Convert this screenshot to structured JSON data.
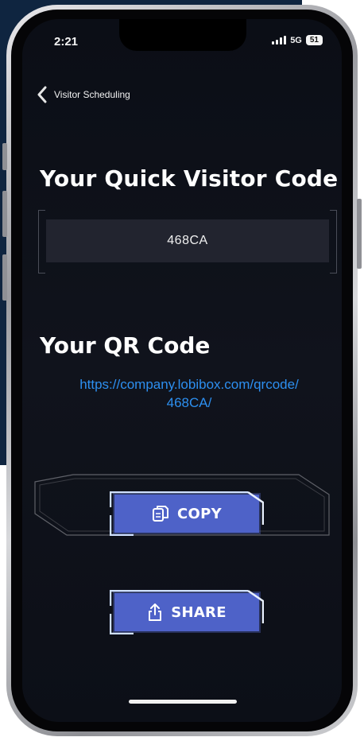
{
  "status_bar": {
    "time": "2:21",
    "network": "5G",
    "battery": "51"
  },
  "nav": {
    "back_label": "Visitor Scheduling"
  },
  "visitor_code_section": {
    "heading": "Your Quick Visitor Code",
    "code": "468CA"
  },
  "qr_section": {
    "heading": "Your QR Code",
    "link_line1": "https://company.lobibox.com/qrcode/",
    "link_line2": "468CA/"
  },
  "buttons": {
    "copy_label": "COPY",
    "share_label": "SHARE"
  },
  "icons": {
    "back": "chevron-left-icon",
    "copy": "copy-icon",
    "share": "share-icon",
    "signal": "signal-icon",
    "battery": "battery-icon"
  },
  "colors": {
    "screen_bg": "#0b0e16",
    "accent_blue": "#5b6fd6",
    "link_blue": "#2d8ff0",
    "code_box": "#22242f",
    "page_bg_panel": "#0f2540"
  }
}
